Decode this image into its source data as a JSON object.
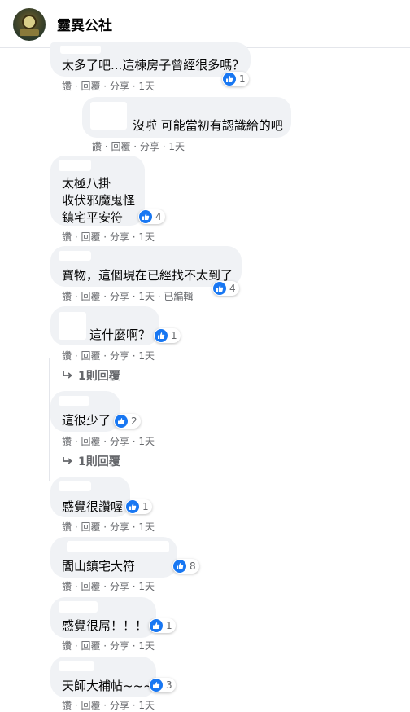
{
  "header": {
    "title": "靈異公社"
  },
  "comments": [
    {
      "text": "太多了吧...這棟房子曾經很多嗎？",
      "reactions": "1",
      "actions": "讚 · 回覆 · 分享 · 1天"
    },
    {
      "text": "沒啦 可能當初有認識給的吧",
      "reactions": "",
      "actions": "讚 · 回覆 · 分享 · 1天"
    },
    {
      "lines": [
        "太極八掛",
        "收伏邪魔鬼怪",
        "鎮宅平安符"
      ],
      "reactions": "4",
      "actions": "讚 · 回覆 · 分享 · 1天"
    },
    {
      "text": "寶物，這個現在已經找不太到了",
      "reactions": "4",
      "actions": "讚 · 回覆 · 分享 · 1天 · 已編輯"
    },
    {
      "text": "這什麼啊？",
      "reactions": "1",
      "actions": "讚 · 回覆 · 分享 · 1天",
      "replies": "1則回覆"
    },
    {
      "text": "這很少了",
      "reactions": "2",
      "actions": "讚 · 回覆 · 分享 · 1天",
      "replies": "1則回覆"
    },
    {
      "text": "感覺很讚喔",
      "reactions": "1",
      "actions": "讚 · 回覆 · 分享 · 1天"
    },
    {
      "text": "閭山鎮宅大符",
      "reactions": "8",
      "actions": "讚 · 回覆 · 分享 · 1天"
    },
    {
      "text": "感覺很屌！！！",
      "reactions": "1",
      "actions": "讚 · 回覆 · 分享 · 1天"
    },
    {
      "text": "天師大補帖~~~",
      "reactions": "3",
      "actions": "讚 · 回覆 · 分享 · 1天"
    }
  ],
  "icons": {
    "like": "thumbs-up-icon",
    "reply_arrow": "reply-arrow-icon",
    "avatar": "page-avatar"
  },
  "colors": {
    "like_blue": "#1877f2",
    "bubble_bg": "#f0f2f5",
    "meta_gray": "#65676b"
  }
}
